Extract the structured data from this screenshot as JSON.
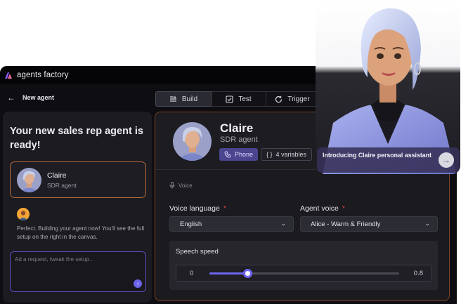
{
  "app": {
    "brand": "agents factory"
  },
  "header": {
    "back_label": "New agent"
  },
  "tabs": [
    {
      "label": "Build",
      "icon": "build-icon",
      "active": true
    },
    {
      "label": "Test",
      "icon": "checkbox-icon",
      "active": false
    },
    {
      "label": "Trigger",
      "icon": "refresh-icon",
      "active": false
    }
  ],
  "chat": {
    "title": "Your new sales rep agent is ready!",
    "agent_card": {
      "name": "Claire",
      "role": "SDR agent"
    },
    "message": "Perfect. Building your agent now! You'll see the full setup on the right in the canvas.",
    "input_placeholder": "Ad a request, tweak the setup..."
  },
  "profile": {
    "name": "Claire",
    "role": "SDR agent",
    "chip_phone": "Phone",
    "chip_vars": "4 variables"
  },
  "voice": {
    "section_label": "Voice",
    "language_label": "Voice language",
    "language_value": "English",
    "agent_voice_label": "Agent voice",
    "agent_voice_value": "Alice - Warm & Friendly",
    "required_mark": "*"
  },
  "speed": {
    "label": "Speech speed",
    "min": "0",
    "max": "0.8",
    "value_fraction": 0.2
  },
  "intro": {
    "text": "Introducing Claire personal assistant"
  },
  "colors": {
    "accent": "#6e66f0",
    "card_border": "#b86a3a",
    "required": "#e04a4a"
  }
}
